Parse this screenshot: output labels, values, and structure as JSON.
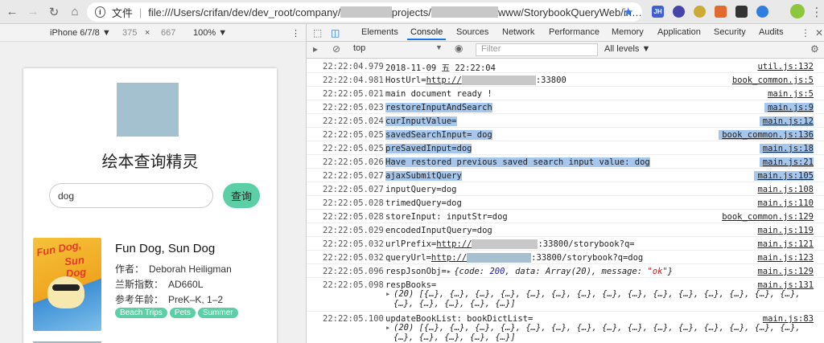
{
  "browser": {
    "url_scheme": "文件",
    "url_part1": "file:///Users/crifan/dev/dev_root/company/",
    "url_part2": "projects/",
    "url_part3": "www/StorybookQueryWeb/in…",
    "extensions": [
      {
        "name": "jh-extension-icon",
        "label": "JH",
        "color": "#3f5fd6"
      },
      {
        "name": "extension-icon-2",
        "label": "",
        "color": "#4444aa"
      },
      {
        "name": "extension-icon-3",
        "label": "",
        "color": "#ccaa33"
      },
      {
        "name": "extension-icon-4",
        "label": "",
        "color": "#e26a2c"
      },
      {
        "name": "qr-extension-icon",
        "label": "",
        "color": "#333333"
      },
      {
        "name": "extension-icon-6",
        "label": "",
        "color": "#2f7de1"
      }
    ]
  },
  "device_bar": {
    "device": "iPhone 6/7/8 ▼",
    "width": "375",
    "times": "×",
    "height": "667",
    "zoom": "100% ▼",
    "more": "⋮"
  },
  "app": {
    "title": "绘本查询精灵",
    "search_value": "dog",
    "search_button": "查询",
    "book": {
      "title": "Fun Dog, Sun Dog",
      "cover_text_1": "Fun Dog,",
      "cover_text_2": "Sun Dog",
      "author_label": "作者：",
      "author": "Deborah Heiligman",
      "lexile_label": "兰斯指数：",
      "lexile": "AD660L",
      "age_label": "参考年龄：",
      "age": "PreK–K, 1–2",
      "tags": [
        "Beach Trips",
        "Pets",
        "Summer"
      ]
    }
  },
  "devtools": {
    "tabs": [
      "Elements",
      "Console",
      "Sources",
      "Network",
      "Performance",
      "Memory",
      "Application",
      "Security",
      "Audits"
    ],
    "active_tab": "Console",
    "context": "top",
    "filter_placeholder": "Filter",
    "levels": "All levels ▼",
    "logs": [
      {
        "ts": "22:22:04.979",
        "msg": "2018-11-09 五 22:22:04",
        "src": "util.js:132",
        "hl": false
      },
      {
        "ts": "22:22:04.981",
        "msg_pre": "HostUrl=",
        "msg_link": "http://",
        "msg_post": ":33800",
        "src": "book_common.js:5",
        "hl": false,
        "redact": true
      },
      {
        "ts": "22:22:05.021",
        "msg": "main document ready !",
        "src": "main.js:5",
        "hl": false
      },
      {
        "ts": "22:22:05.023",
        "msg": "restoreInputAndSearch",
        "src": "main.js:9",
        "hl": true
      },
      {
        "ts": "22:22:05.024",
        "msg": "curInputValue=",
        "src": "main.js:12",
        "hl": true
      },
      {
        "ts": "22:22:05.025",
        "msg": "savedSearchInput= dog",
        "src": "book_common.js:136",
        "hl": true
      },
      {
        "ts": "22:22:05.025",
        "msg": "preSavedInput=dog",
        "src": "main.js:18",
        "hl": true
      },
      {
        "ts": "22:22:05.026",
        "msg": "Have restored previous saved search input value: dog",
        "src": "main.js:21",
        "hl": true
      },
      {
        "ts": "22:22:05.027",
        "msg": "ajaxSubmitQuery",
        "src": "main.js:105",
        "hl": true
      },
      {
        "ts": "22:22:05.027",
        "msg": "inputQuery=dog",
        "src": "main.js:108",
        "hl": false
      },
      {
        "ts": "22:22:05.028",
        "msg": "trimedQuery=dog",
        "src": "main.js:110",
        "hl": false
      },
      {
        "ts": "22:22:05.028",
        "msg": "storeInput: inputStr=dog",
        "src": "book_common.js:129",
        "hl": false
      },
      {
        "ts": "22:22:05.029",
        "msg": "encodedInputQuery=dog",
        "src": "main.js:119",
        "hl": false
      },
      {
        "ts": "22:22:05.032",
        "msg_pre": "urlPrefix=",
        "msg_link": "http://",
        "msg_post": ":33800/storybook?q=",
        "src": "main.js:121",
        "hl": false,
        "redact": true
      },
      {
        "ts": "22:22:05.032",
        "msg_pre": "queryUrl=",
        "msg_link": "http://",
        "msg_post": ":33800/storybook?q=dog",
        "src": "main.js:123",
        "hl": false,
        "redact": true
      },
      {
        "ts": "22:22:05.096",
        "msg": "respJsonObj=",
        "src": "main.js:129",
        "hl": false,
        "obj": true
      },
      {
        "ts": "22:22:05.098",
        "msg": "respBooks=",
        "src": "main.js:131",
        "hl": false
      },
      {
        "ts": "22:22:05.100",
        "msg": "updateBookList: bookDictList=",
        "src": "main.js:83",
        "hl": false
      }
    ],
    "resp_obj": {
      "p1": "{code: ",
      "code": "200",
      "p2": ", data: Array(20), message: ",
      "message": "\"ok\"",
      "p3": "}"
    },
    "array_lines": {
      "first": "(20) [{…}, {…}, {…}, {…}, {…}, {…}, {…}, {…}, {…}, {…}, {…}, {…}, {…}, {…}, {…},",
      "cont": "{…}, {…}, {…}, {…}, {…}]",
      "second_first": "(20) [{…}, {…}, {…}, {…}, {…}, {…}, {…}, {…}, {…}, {…}, {…}, {…}, {…}, {…}, {…},"
    }
  }
}
